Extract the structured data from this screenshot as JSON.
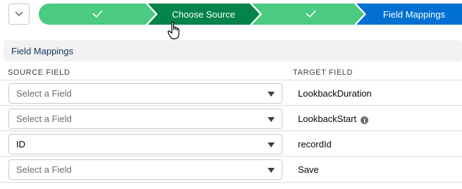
{
  "path": {
    "steps": [
      {
        "label": "",
        "state": "complete",
        "icon": "check-icon"
      },
      {
        "label": "Choose Source",
        "state": "complete-active",
        "icon": ""
      },
      {
        "label": "",
        "state": "complete",
        "icon": "check-icon"
      },
      {
        "label": "Field Mappings",
        "state": "current",
        "icon": ""
      }
    ],
    "colors": {
      "complete": "#4bca81",
      "active_complete": "#04844b",
      "current": "#0070d2"
    }
  },
  "section": {
    "title": "Field Mappings"
  },
  "table": {
    "headers": {
      "source": "SOURCE FIELD",
      "target": "TARGET FIELD"
    },
    "rows": [
      {
        "source_value": "Select a Field",
        "target": "LookbackDuration",
        "info": false
      },
      {
        "source_value": "Select a Field",
        "target": "LookbackStart",
        "info": true
      },
      {
        "source_value": "ID",
        "target": "recordId",
        "info": false
      },
      {
        "source_value": "Select a Field",
        "target": "Save",
        "info": false
      }
    ]
  }
}
